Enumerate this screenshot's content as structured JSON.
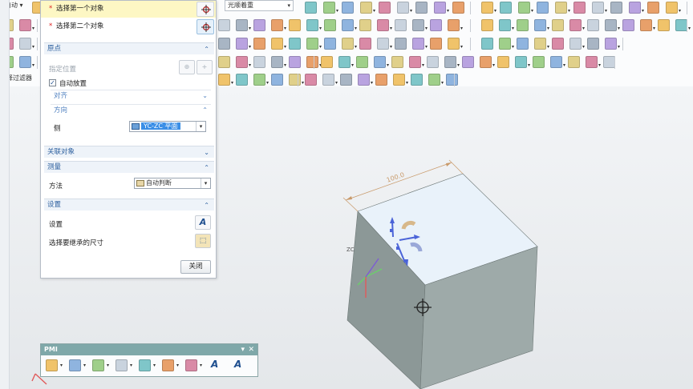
{
  "toolbar": {
    "auto_label": "自动",
    "view_select_value": "光顺着重",
    "filter_label": "选择过滤器"
  },
  "dialog": {
    "select_first": "选择第一个对象",
    "select_second": "选择第二个对象",
    "origin_section": "原点",
    "specify_location": "指定位置",
    "auto_place": "自动放置",
    "auto_place_checked": true,
    "align": "对齐",
    "direction": "方向",
    "side_label": "侧",
    "side_value": "YC-ZC 平面",
    "associated_objects": "关联对象",
    "measurement": "测量",
    "method_label": "方法",
    "method_value": "自动判断",
    "settings_section": "设置",
    "settings_label": "设置",
    "inherit_label": "选择要继承的尺寸",
    "close_button": "关闭"
  },
  "pmi_toolbar": {
    "title": "PMI"
  },
  "model": {
    "dimension_text": "100.0",
    "axis_label": "ZC"
  },
  "colors": {
    "accent_blue": "#3a8ee6",
    "active_row": "#fdf7c4",
    "pmi_title_bar": "#7fa8a9",
    "cube_top": "#e9f2fa",
    "cube_front": "#9eaaa9",
    "cube_side": "#8c9897"
  },
  "icons": [
    "crosshair-icon",
    "chevron-up-icon",
    "chevron-down-icon",
    "plane-icon",
    "auto-dimension-icon",
    "text-A-icon",
    "inherit-dimension-icon",
    "close-icon",
    "minimize-icon",
    "triad-axes-icon",
    "dynamic-handle-icon",
    "cursor-crosshair-icon"
  ]
}
